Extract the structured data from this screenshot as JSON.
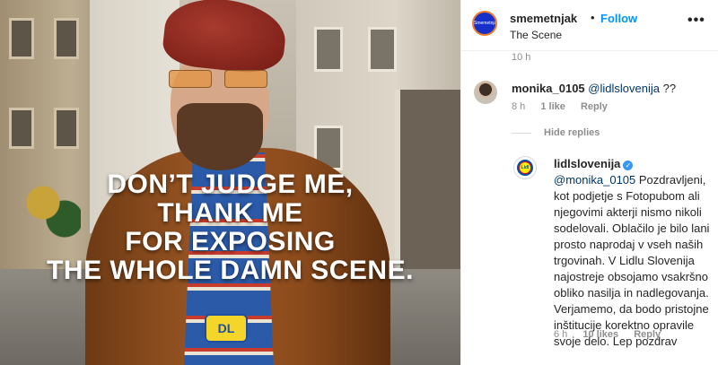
{
  "photo": {
    "headline_lines": [
      "DON’T JUDGE ME,",
      "THANK ME",
      "FOR EXPOSING",
      "THE WHOLE DAMN SCENE."
    ],
    "sweater_patch": "DL"
  },
  "post_header": {
    "avatar_text": "Smemetnjak",
    "username": "smemetnjak",
    "separator": "•",
    "follow_label": "Follow",
    "location": "The Scene",
    "more_icon": "more-horizontal-icon"
  },
  "previous_time": "10 h",
  "comments": [
    {
      "username": "monika_0105",
      "mention": "@lidlslovenija",
      "text": " ??",
      "time": "8 h",
      "likes": "1 like",
      "reply_label": "Reply"
    }
  ],
  "hide_replies_label": "Hide replies",
  "reply": {
    "username": "lidlslovenija",
    "verified_icon": "verified-badge-icon",
    "verified_glyph": "✓",
    "mention": "@monika_0105",
    "logo_text": "Lidl",
    "text": "Pozdravljeni, kot podjetje s Fotopubom ali njegovimi akterji nismo nikoli sodelovali. Oblačilo je bilo lani prosto naprodaj v vseh naših trgovinah. V Lidlu Slovenija najostreje obsojamo vsakršno obliko nasilja in nadlegovanja. Verjamemo, da bodo pristojne inštitucije korektno opravile svoje delo. Lep pozdrav",
    "time": "6 h",
    "likes": "10 likes",
    "reply_label": "Reply"
  },
  "colors": {
    "link_blue": "#0095f6",
    "mention_blue": "#00376b",
    "muted": "#8e8e8e",
    "verified": "#3897f0"
  }
}
